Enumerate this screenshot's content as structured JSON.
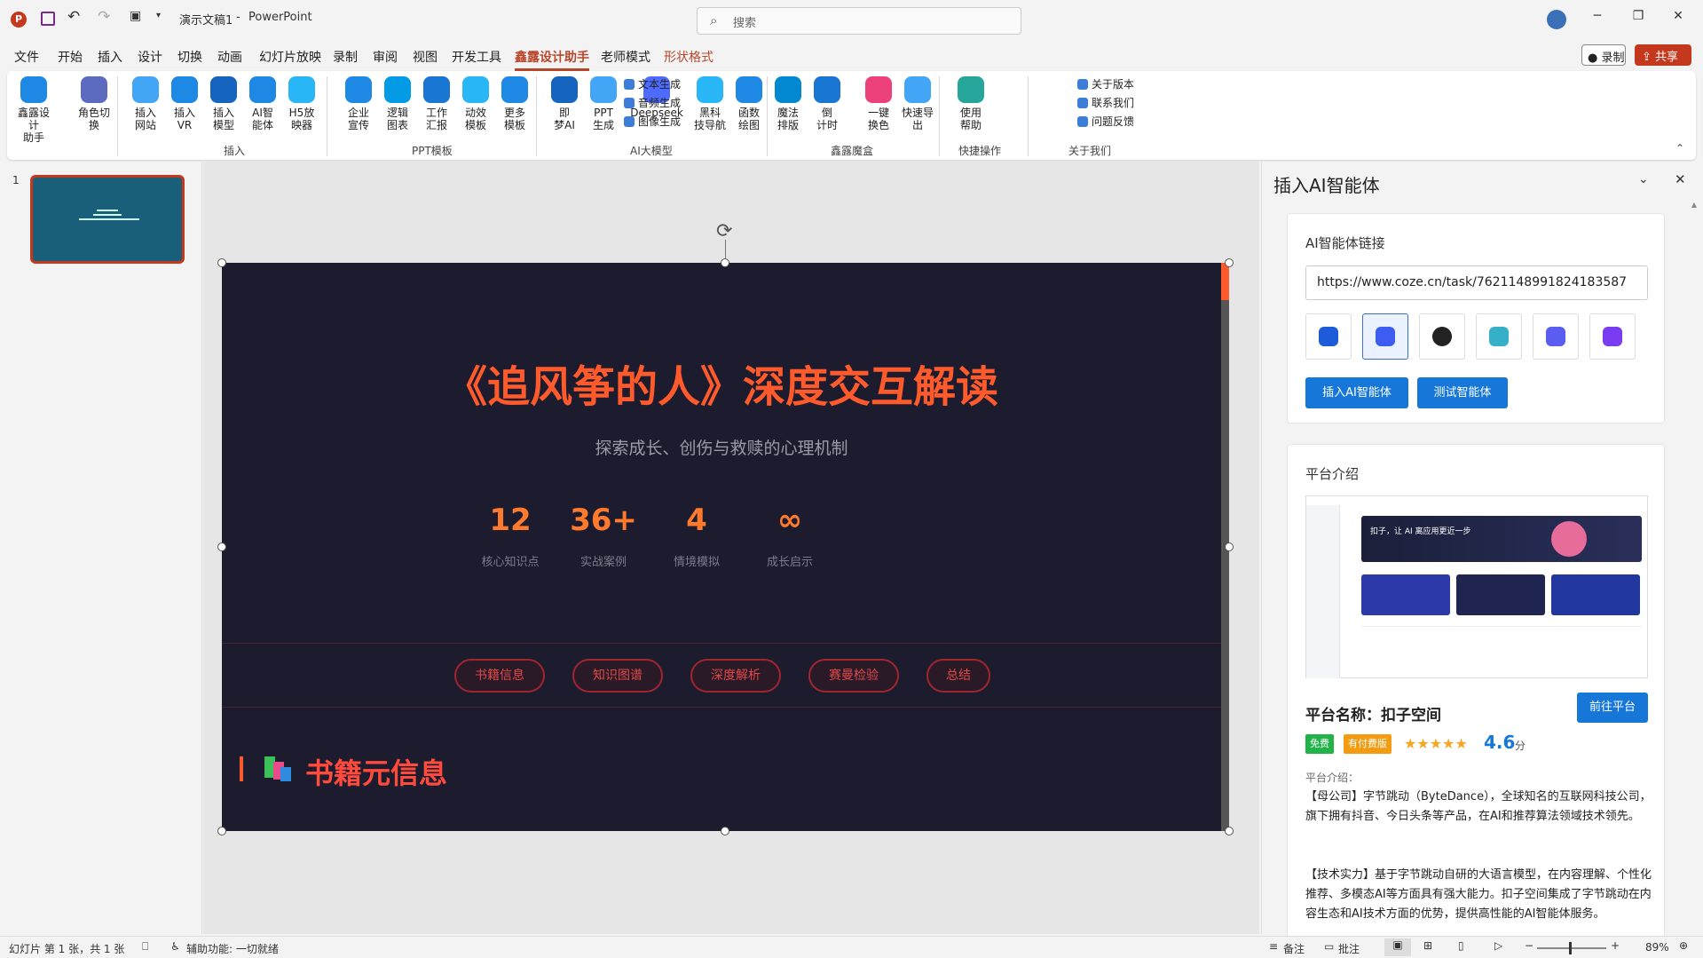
{
  "title": {
    "autosave_icon": "save-icon",
    "doc_name": "演示文稿1",
    "sep": "-",
    "app_name": "PowerPoint",
    "search_placeholder": "搜索"
  },
  "menu": [
    "文件",
    "开始",
    "插入",
    "设计",
    "切换",
    "动画",
    "幻灯片放映",
    "录制",
    "审阅",
    "视图",
    "开发工具",
    "鑫露设计助手",
    "老师模式",
    "形状格式"
  ],
  "menu_active": "鑫露设计助手",
  "record_label": "录制",
  "share_label": "共享",
  "ribbon": {
    "buttons": [
      {
        "l1": "鑫露设计",
        "l2": "助手",
        "c": "#1e88e5"
      },
      {
        "l1": "角色切",
        "l2": "换",
        "c": "#5c6bc0"
      },
      {
        "l1": "插入",
        "l2": "网站",
        "c": "#42a5f5"
      },
      {
        "l1": "插入",
        "l2": "VR",
        "c": "#1e88e5"
      },
      {
        "l1": "插入",
        "l2": "模型",
        "c": "#1565c0"
      },
      {
        "l1": "AI智",
        "l2": "能体",
        "c": "#1e88e5"
      },
      {
        "l1": "H5放",
        "l2": "映器",
        "c": "#29b6f6"
      },
      {
        "l1": "企业",
        "l2": "宣传",
        "c": "#1e88e5"
      },
      {
        "l1": "逻辑",
        "l2": "图表",
        "c": "#039be5"
      },
      {
        "l1": "工作",
        "l2": "汇报",
        "c": "#1976d2"
      },
      {
        "l1": "动效",
        "l2": "模板",
        "c": "#29b6f6"
      },
      {
        "l1": "更多",
        "l2": "模板",
        "c": "#1e88e5"
      },
      {
        "l1": "即",
        "l2": "梦AI",
        "c": "#1565c0"
      },
      {
        "l1": "PPT",
        "l2": "生成",
        "c": "#42a5f5"
      },
      {
        "l1": "Deepseek",
        "l2": "",
        "c": "#4d6bfe"
      },
      {
        "l1": "黑科",
        "l2": "技导航",
        "c": "#29b6f6"
      },
      {
        "l1": "函数",
        "l2": "绘图",
        "c": "#1e88e5"
      },
      {
        "l1": "魔法",
        "l2": "排版",
        "c": "#0288d1"
      },
      {
        "l1": "倒",
        "l2": "计时",
        "c": "#1976d2"
      },
      {
        "l1": "一键",
        "l2": "换色",
        "c": "#ec407a"
      },
      {
        "l1": "快速导",
        "l2": "出",
        "c": "#42a5f5"
      },
      {
        "l1": "使用",
        "l2": "帮助",
        "c": "#26a69a"
      }
    ],
    "small": [
      "文本生成",
      "音频生成",
      "图像生成",
      "关于版本",
      "联系我们",
      "问题反馈"
    ],
    "groups": [
      "插入",
      "PPT模板",
      "AI大模型",
      "鑫露魔盒",
      "快捷操作",
      "关于我们"
    ]
  },
  "slide_number": "1",
  "slide": {
    "title": "《追风筝的人》深度交互解读",
    "subtitle": "探索成长、创伤与救赎的心理机制",
    "stats": [
      {
        "v": "12",
        "l": "核心知识点"
      },
      {
        "v": "36+",
        "l": "实战案例"
      },
      {
        "v": "4",
        "l": "情境模拟"
      },
      {
        "v": "∞",
        "l": "成长启示"
      }
    ],
    "tabs": [
      "书籍信息",
      "知识图谱",
      "深度解析",
      "赛曼检验",
      "总结"
    ],
    "section": "书籍元信息",
    "accent": "#ff5a2c"
  },
  "pane": {
    "title": "插入AI智能体",
    "link_label": "AI智能体链接",
    "link_value": "https://www.coze.cn/task/7621148991824183587",
    "insert_btn": "插入AI智能体",
    "test_btn": "测试智能体",
    "intro_label": "平台介绍",
    "platform_name_label": "平台名称：扣子空间",
    "goto_btn": "前往平台",
    "badge_free": "免费",
    "badge_paid": "有付费版",
    "stars": "★★★★★",
    "rating": "4.6",
    "rating_unit": "分",
    "desc_label": "平台介绍：",
    "desc1": "【母公司】字节跳动（ByteDance），全球知名的互联网科技公司，旗下拥有抖音、今日头条等产品，在AI和推荐算法领域技术领先。",
    "desc2": "【技术实力】基于字节跳动自研的大语言模型，在内容理解、个性化推荐、多模态AI等方面具有强大能力。扣子空间集成了字节跳动在内容生态和AI技术方面的优势，提供高性能的AI智能体服务。",
    "shot_banner": "扣子，让 AI 离应用更近一步"
  },
  "status": {
    "left": "幻灯片 第 1 张，共 1 张",
    "access": "辅助功能: 一切就绪",
    "notes": "备注",
    "comments": "批注",
    "zoom": "89%"
  }
}
